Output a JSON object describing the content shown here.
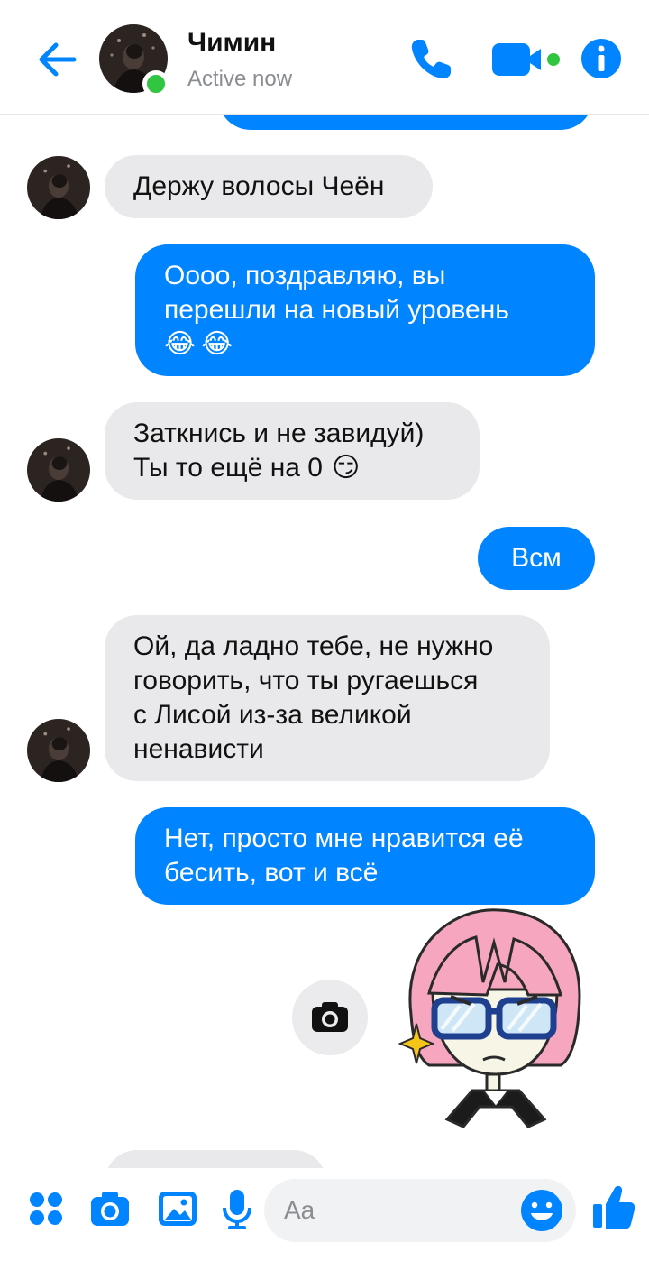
{
  "header": {
    "name": "Чимин",
    "status": "Active now"
  },
  "messages": [
    {
      "id": "m1",
      "direction": "in",
      "lines": [
        "Держу волосы Чеён"
      ]
    },
    {
      "id": "m2",
      "direction": "out",
      "lines": [
        "Оооо, поздравляю, вы",
        "перешли на новый уровень"
      ],
      "emoji": [
        "😂",
        "😂"
      ]
    },
    {
      "id": "m3",
      "direction": "in",
      "lines": [
        "Заткнись и не завидуй)",
        "Ты то ещё на 0"
      ],
      "emoji": [
        "😏"
      ]
    },
    {
      "id": "m4",
      "direction": "out",
      "lines": [
        "Всм"
      ]
    },
    {
      "id": "m5",
      "direction": "in",
      "lines": [
        "Ой, да ладно тебе, не нужно",
        "говорить, что ты ругаешься",
        "с Лисой из-за великой",
        "ненависти"
      ]
    },
    {
      "id": "m6",
      "direction": "out",
      "lines": [
        "Нет, просто мне нравится её",
        "бесить, вот и всё"
      ]
    }
  ],
  "composer": {
    "placeholder": "Aa"
  },
  "colors": {
    "accent": "#0084ff",
    "incoming_bubble": "#e9e9eb",
    "online": "#31c541"
  },
  "icons": [
    "back-arrow-icon",
    "phone-icon",
    "video-camera-icon",
    "info-icon",
    "camera-icon",
    "apps-grid-icon",
    "gallery-icon",
    "microphone-icon",
    "emoji-icon",
    "thumbs-up-icon"
  ]
}
